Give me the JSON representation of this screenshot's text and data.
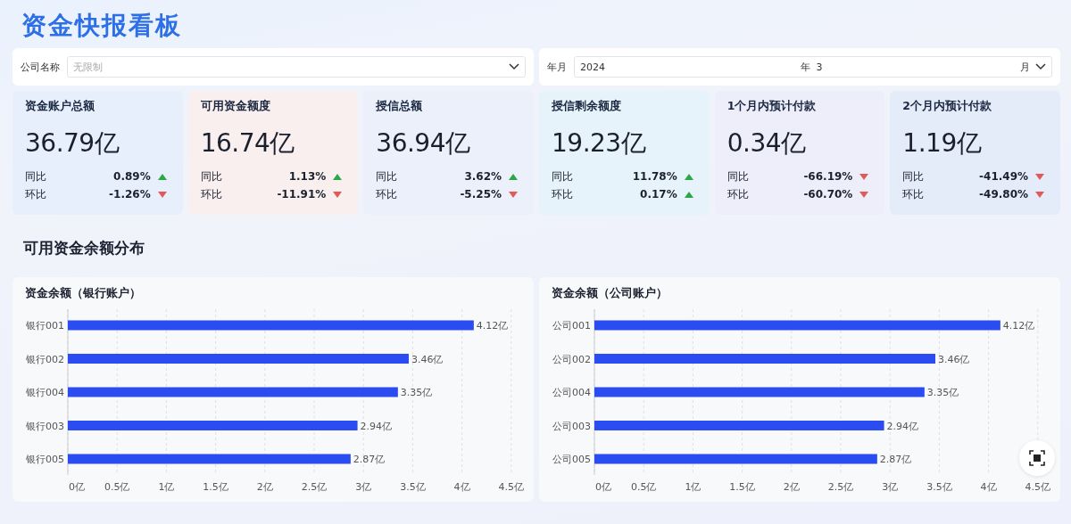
{
  "title": "资金快报看板",
  "filters": {
    "company": {
      "label": "公司名称",
      "placeholder": "无限制"
    },
    "period": {
      "label": "年月",
      "year": "2024",
      "year_unit": "年",
      "month": "3",
      "month_unit": "月"
    }
  },
  "cards": [
    {
      "title": "资金账户总额",
      "value": "36.79亿",
      "yoy": {
        "label": "同比",
        "value": "0.89%",
        "up": true
      },
      "mom": {
        "label": "环比",
        "value": "-1.26%",
        "up": false
      }
    },
    {
      "title": "可用资金额度",
      "value": "16.74亿",
      "yoy": {
        "label": "同比",
        "value": "1.13%",
        "up": true
      },
      "mom": {
        "label": "环比",
        "value": "-11.91%",
        "up": false
      }
    },
    {
      "title": "授信总额",
      "value": "36.94亿",
      "yoy": {
        "label": "同比",
        "value": "3.62%",
        "up": true
      },
      "mom": {
        "label": "环比",
        "value": "-5.25%",
        "up": false
      }
    },
    {
      "title": "授信剩余额度",
      "value": "19.23亿",
      "yoy": {
        "label": "同比",
        "value": "11.78%",
        "up": true
      },
      "mom": {
        "label": "环比",
        "value": "0.17%",
        "up": true
      }
    },
    {
      "title": "1个月内预计付款",
      "value": "0.34亿",
      "yoy": {
        "label": "同比",
        "value": "-66.19%",
        "up": false
      },
      "mom": {
        "label": "环比",
        "value": "-60.70%",
        "up": false
      }
    },
    {
      "title": "2个月内预计付款",
      "value": "1.19亿",
      "yoy": {
        "label": "同比",
        "value": "-41.49%",
        "up": false
      },
      "mom": {
        "label": "环比",
        "value": "-49.80%",
        "up": false
      }
    }
  ],
  "section_title": "可用资金余额分布",
  "charts": [
    {
      "title": "资金余额（银行账户）",
      "chart_data": {
        "type": "bar",
        "orientation": "horizontal",
        "grid": true,
        "categories": [
          "银行001",
          "银行002",
          "银行004",
          "银行003",
          "银行005"
        ],
        "values": [
          4.12,
          3.46,
          3.35,
          2.94,
          2.87
        ],
        "value_labels": [
          "4.12亿",
          "3.46亿",
          "3.35亿",
          "2.94亿",
          "2.87亿"
        ],
        "xlim": [
          0,
          4.5
        ],
        "xticks": [
          {
            "value": 0,
            "label": "0亿"
          },
          {
            "value": 0.5,
            "label": "0.5亿"
          },
          {
            "value": 1,
            "label": "1亿"
          },
          {
            "value": 1.5,
            "label": "1.5亿"
          },
          {
            "value": 2,
            "label": "2亿"
          },
          {
            "value": 2.5,
            "label": "2.5亿"
          },
          {
            "value": 3,
            "label": "3亿"
          },
          {
            "value": 3.5,
            "label": "3.5亿"
          },
          {
            "value": 4,
            "label": "4亿"
          },
          {
            "value": 4.5,
            "label": "4.5亿"
          }
        ]
      }
    },
    {
      "title": "资金余额（公司账户）",
      "chart_data": {
        "type": "bar",
        "orientation": "horizontal",
        "grid": true,
        "categories": [
          "公司001",
          "公司002",
          "公司004",
          "公司003",
          "公司005"
        ],
        "values": [
          4.12,
          3.46,
          3.35,
          2.94,
          2.87
        ],
        "value_labels": [
          "4.12亿",
          "3.46亿",
          "3.35亿",
          "2.94亿",
          "2.87亿"
        ],
        "xlim": [
          0,
          4.5
        ],
        "xticks": [
          {
            "value": 0,
            "label": "0亿"
          },
          {
            "value": 0.5,
            "label": "0.5亿"
          },
          {
            "value": 1,
            "label": "1亿"
          },
          {
            "value": 1.5,
            "label": "1.5亿"
          },
          {
            "value": 2,
            "label": "2亿"
          },
          {
            "value": 2.5,
            "label": "2.5亿"
          },
          {
            "value": 3,
            "label": "3亿"
          },
          {
            "value": 3.5,
            "label": "3.5亿"
          },
          {
            "value": 4,
            "label": "4亿"
          },
          {
            "value": 4.5,
            "label": "4.5亿"
          }
        ]
      }
    }
  ]
}
